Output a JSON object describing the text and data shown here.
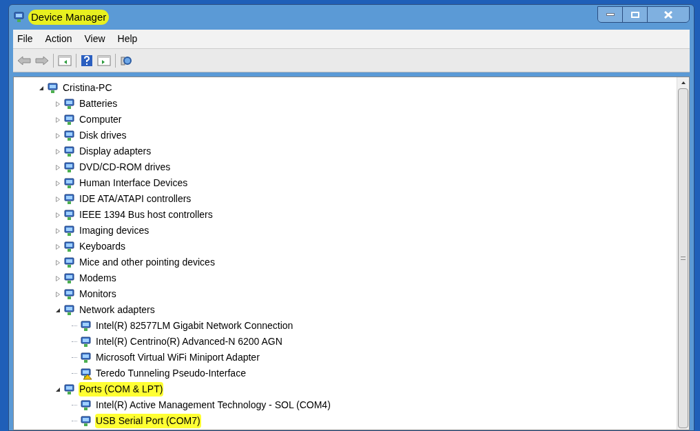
{
  "window": {
    "title": "Device Manager",
    "title_highlighted": true
  },
  "menu": [
    "File",
    "Action",
    "View",
    "Help"
  ],
  "tree": {
    "label": "Cristina-PC",
    "expanded": true,
    "highlighted": false,
    "children": [
      {
        "label": "Batteries",
        "expanded": false,
        "highlighted": false
      },
      {
        "label": "Computer",
        "expanded": false,
        "highlighted": false
      },
      {
        "label": "Disk drives",
        "expanded": false,
        "highlighted": false
      },
      {
        "label": "Display adapters",
        "expanded": false,
        "highlighted": false
      },
      {
        "label": "DVD/CD-ROM drives",
        "expanded": false,
        "highlighted": false
      },
      {
        "label": "Human Interface Devices",
        "expanded": false,
        "highlighted": false
      },
      {
        "label": "IDE ATA/ATAPI controllers",
        "expanded": false,
        "highlighted": false
      },
      {
        "label": "IEEE 1394 Bus host controllers",
        "expanded": false,
        "highlighted": false
      },
      {
        "label": "Imaging devices",
        "expanded": false,
        "highlighted": false
      },
      {
        "label": "Keyboards",
        "expanded": false,
        "highlighted": false
      },
      {
        "label": "Mice and other pointing devices",
        "expanded": false,
        "highlighted": false
      },
      {
        "label": "Modems",
        "expanded": false,
        "highlighted": false
      },
      {
        "label": "Monitors",
        "expanded": false,
        "highlighted": false
      },
      {
        "label": "Network adapters",
        "expanded": true,
        "highlighted": false,
        "children": [
          {
            "label": "Intel(R) 82577LM Gigabit Network Connection",
            "highlighted": false,
            "warning": false
          },
          {
            "label": "Intel(R) Centrino(R) Advanced-N 6200 AGN",
            "highlighted": false,
            "warning": false
          },
          {
            "label": "Microsoft Virtual WiFi Miniport Adapter",
            "highlighted": false,
            "warning": false
          },
          {
            "label": "Teredo Tunneling Pseudo-Interface",
            "highlighted": false,
            "warning": true
          }
        ]
      },
      {
        "label": "Ports (COM & LPT)",
        "expanded": true,
        "highlighted": true,
        "children": [
          {
            "label": "Intel(R) Active Management Technology - SOL (COM4)",
            "highlighted": false,
            "warning": false
          },
          {
            "label": "USB Serial Port (COM7)",
            "highlighted": true,
            "warning": false
          }
        ]
      }
    ]
  }
}
